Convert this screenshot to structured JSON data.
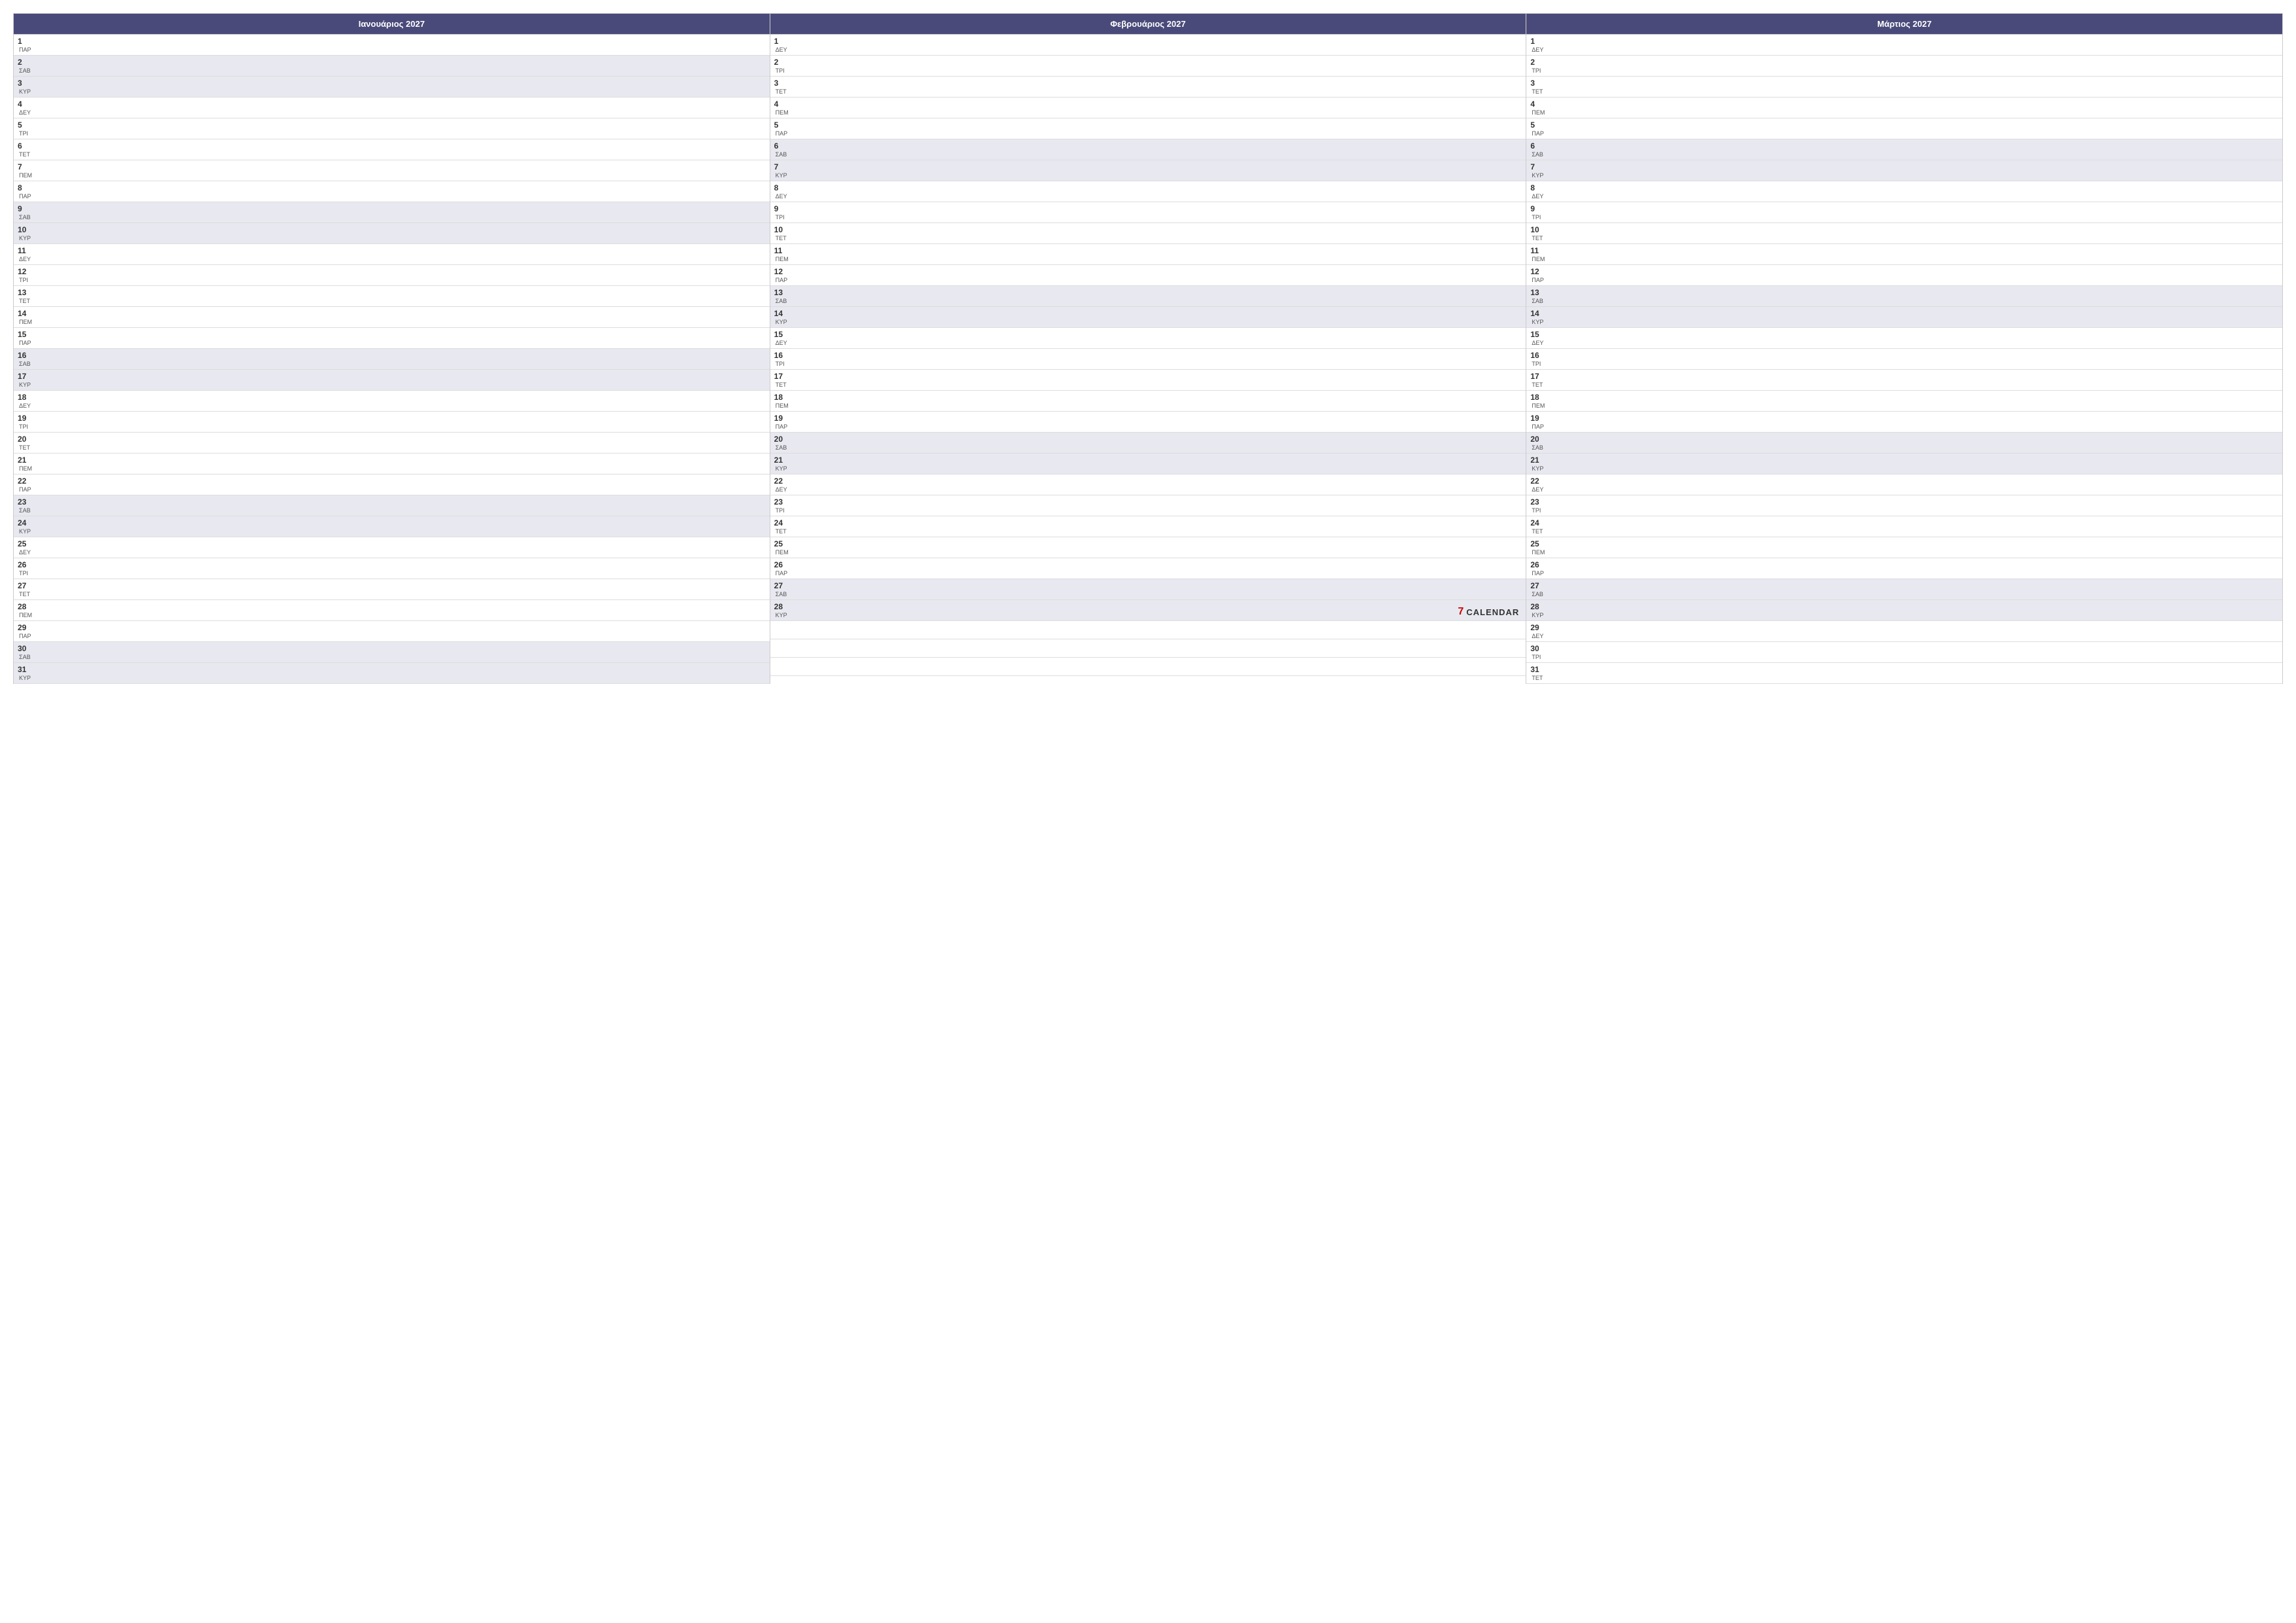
{
  "months": [
    {
      "id": "january",
      "label": "Ιανουάριος 2027",
      "days": [
        {
          "num": "1",
          "name": "ΠΑΡ",
          "weekend": false
        },
        {
          "num": "2",
          "name": "ΣΑΒ",
          "weekend": true
        },
        {
          "num": "3",
          "name": "ΚΥΡ",
          "weekend": true
        },
        {
          "num": "4",
          "name": "ΔΕΥ",
          "weekend": false
        },
        {
          "num": "5",
          "name": "ΤΡΙ",
          "weekend": false
        },
        {
          "num": "6",
          "name": "ΤΕΤ",
          "weekend": false
        },
        {
          "num": "7",
          "name": "ΠΕΜ",
          "weekend": false
        },
        {
          "num": "8",
          "name": "ΠΑΡ",
          "weekend": false
        },
        {
          "num": "9",
          "name": "ΣΑΒ",
          "weekend": true
        },
        {
          "num": "10",
          "name": "ΚΥΡ",
          "weekend": true
        },
        {
          "num": "11",
          "name": "ΔΕΥ",
          "weekend": false
        },
        {
          "num": "12",
          "name": "ΤΡΙ",
          "weekend": false
        },
        {
          "num": "13",
          "name": "ΤΕΤ",
          "weekend": false
        },
        {
          "num": "14",
          "name": "ΠΕΜ",
          "weekend": false
        },
        {
          "num": "15",
          "name": "ΠΑΡ",
          "weekend": false
        },
        {
          "num": "16",
          "name": "ΣΑΒ",
          "weekend": true
        },
        {
          "num": "17",
          "name": "ΚΥΡ",
          "weekend": true
        },
        {
          "num": "18",
          "name": "ΔΕΥ",
          "weekend": false
        },
        {
          "num": "19",
          "name": "ΤΡΙ",
          "weekend": false
        },
        {
          "num": "20",
          "name": "ΤΕΤ",
          "weekend": false
        },
        {
          "num": "21",
          "name": "ΠΕΜ",
          "weekend": false
        },
        {
          "num": "22",
          "name": "ΠΑΡ",
          "weekend": false
        },
        {
          "num": "23",
          "name": "ΣΑΒ",
          "weekend": true
        },
        {
          "num": "24",
          "name": "ΚΥΡ",
          "weekend": true
        },
        {
          "num": "25",
          "name": "ΔΕΥ",
          "weekend": false
        },
        {
          "num": "26",
          "name": "ΤΡΙ",
          "weekend": false
        },
        {
          "num": "27",
          "name": "ΤΕΤ",
          "weekend": false
        },
        {
          "num": "28",
          "name": "ΠΕΜ",
          "weekend": false
        },
        {
          "num": "29",
          "name": "ΠΑΡ",
          "weekend": false
        },
        {
          "num": "30",
          "name": "ΣΑΒ",
          "weekend": true
        },
        {
          "num": "31",
          "name": "ΚΥΡ",
          "weekend": true
        }
      ]
    },
    {
      "id": "february",
      "label": "Φεβρουάριος 2027",
      "days": [
        {
          "num": "1",
          "name": "ΔΕΥ",
          "weekend": false
        },
        {
          "num": "2",
          "name": "ΤΡΙ",
          "weekend": false
        },
        {
          "num": "3",
          "name": "ΤΕΤ",
          "weekend": false
        },
        {
          "num": "4",
          "name": "ΠΕΜ",
          "weekend": false
        },
        {
          "num": "5",
          "name": "ΠΑΡ",
          "weekend": false
        },
        {
          "num": "6",
          "name": "ΣΑΒ",
          "weekend": true
        },
        {
          "num": "7",
          "name": "ΚΥΡ",
          "weekend": true
        },
        {
          "num": "8",
          "name": "ΔΕΥ",
          "weekend": false
        },
        {
          "num": "9",
          "name": "ΤΡΙ",
          "weekend": false
        },
        {
          "num": "10",
          "name": "ΤΕΤ",
          "weekend": false
        },
        {
          "num": "11",
          "name": "ΠΕΜ",
          "weekend": false
        },
        {
          "num": "12",
          "name": "ΠΑΡ",
          "weekend": false
        },
        {
          "num": "13",
          "name": "ΣΑΒ",
          "weekend": true
        },
        {
          "num": "14",
          "name": "ΚΥΡ",
          "weekend": true
        },
        {
          "num": "15",
          "name": "ΔΕΥ",
          "weekend": false
        },
        {
          "num": "16",
          "name": "ΤΡΙ",
          "weekend": false
        },
        {
          "num": "17",
          "name": "ΤΕΤ",
          "weekend": false
        },
        {
          "num": "18",
          "name": "ΠΕΜ",
          "weekend": false
        },
        {
          "num": "19",
          "name": "ΠΑΡ",
          "weekend": false
        },
        {
          "num": "20",
          "name": "ΣΑΒ",
          "weekend": true
        },
        {
          "num": "21",
          "name": "ΚΥΡ",
          "weekend": true
        },
        {
          "num": "22",
          "name": "ΔΕΥ",
          "weekend": false
        },
        {
          "num": "23",
          "name": "ΤΡΙ",
          "weekend": false
        },
        {
          "num": "24",
          "name": "ΤΕΤ",
          "weekend": false
        },
        {
          "num": "25",
          "name": "ΠΕΜ",
          "weekend": false
        },
        {
          "num": "26",
          "name": "ΠΑΡ",
          "weekend": false
        },
        {
          "num": "27",
          "name": "ΣΑΒ",
          "weekend": true
        },
        {
          "num": "28",
          "name": "ΚΥΡ",
          "weekend": true
        }
      ],
      "watermark": {
        "icon": "7",
        "text": "CALENDAR"
      }
    },
    {
      "id": "march",
      "label": "Μάρτιος 2027",
      "days": [
        {
          "num": "1",
          "name": "ΔΕΥ",
          "weekend": false
        },
        {
          "num": "2",
          "name": "ΤΡΙ",
          "weekend": false
        },
        {
          "num": "3",
          "name": "ΤΕΤ",
          "weekend": false
        },
        {
          "num": "4",
          "name": "ΠΕΜ",
          "weekend": false
        },
        {
          "num": "5",
          "name": "ΠΑΡ",
          "weekend": false
        },
        {
          "num": "6",
          "name": "ΣΑΒ",
          "weekend": true
        },
        {
          "num": "7",
          "name": "ΚΥΡ",
          "weekend": true
        },
        {
          "num": "8",
          "name": "ΔΕΥ",
          "weekend": false
        },
        {
          "num": "9",
          "name": "ΤΡΙ",
          "weekend": false
        },
        {
          "num": "10",
          "name": "ΤΕΤ",
          "weekend": false
        },
        {
          "num": "11",
          "name": "ΠΕΜ",
          "weekend": false
        },
        {
          "num": "12",
          "name": "ΠΑΡ",
          "weekend": false
        },
        {
          "num": "13",
          "name": "ΣΑΒ",
          "weekend": true
        },
        {
          "num": "14",
          "name": "ΚΥΡ",
          "weekend": true
        },
        {
          "num": "15",
          "name": "ΔΕΥ",
          "weekend": false
        },
        {
          "num": "16",
          "name": "ΤΡΙ",
          "weekend": false
        },
        {
          "num": "17",
          "name": "ΤΕΤ",
          "weekend": false
        },
        {
          "num": "18",
          "name": "ΠΕΜ",
          "weekend": false
        },
        {
          "num": "19",
          "name": "ΠΑΡ",
          "weekend": false
        },
        {
          "num": "20",
          "name": "ΣΑΒ",
          "weekend": true
        },
        {
          "num": "21",
          "name": "ΚΥΡ",
          "weekend": true
        },
        {
          "num": "22",
          "name": "ΔΕΥ",
          "weekend": false
        },
        {
          "num": "23",
          "name": "ΤΡΙ",
          "weekend": false
        },
        {
          "num": "24",
          "name": "ΤΕΤ",
          "weekend": false
        },
        {
          "num": "25",
          "name": "ΠΕΜ",
          "weekend": false
        },
        {
          "num": "26",
          "name": "ΠΑΡ",
          "weekend": false
        },
        {
          "num": "27",
          "name": "ΣΑΒ",
          "weekend": true
        },
        {
          "num": "28",
          "name": "ΚΥΡ",
          "weekend": true
        },
        {
          "num": "29",
          "name": "ΔΕΥ",
          "weekend": false
        },
        {
          "num": "30",
          "name": "ΤΡΙ",
          "weekend": false
        },
        {
          "num": "31",
          "name": "ΤΕΤ",
          "weekend": false
        }
      ]
    }
  ],
  "watermark": {
    "icon": "7",
    "text": "CALENDAR"
  }
}
